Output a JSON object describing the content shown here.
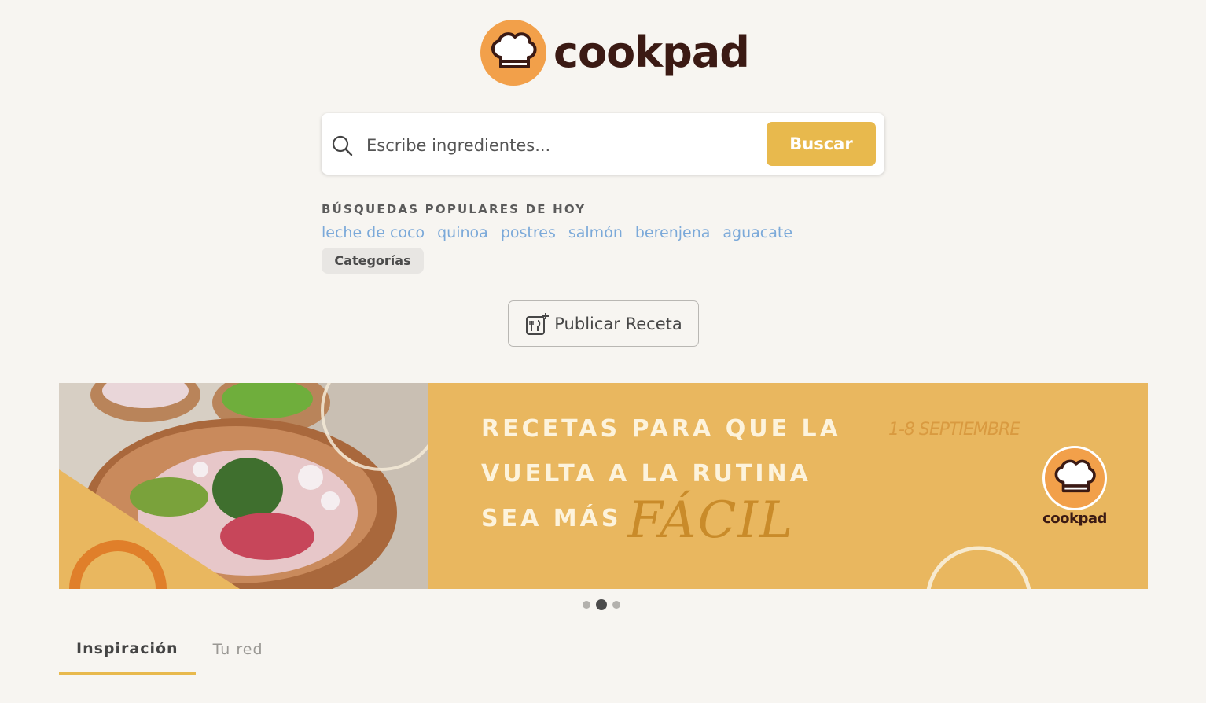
{
  "brand": {
    "name": "cookpad",
    "color": "#f2a04a",
    "accent": "#e8b94d"
  },
  "search": {
    "placeholder": "Escribe ingredientes...",
    "value": "",
    "button_label": "Buscar"
  },
  "popular": {
    "heading": "BÚSQUEDAS POPULARES DE HOY",
    "links": [
      "leche de coco",
      "quinoa",
      "postres",
      "salmón",
      "berenjena",
      "aguacate"
    ],
    "categories_label": "Categorías"
  },
  "publish": {
    "label": "Publicar Receta",
    "icon": "recipe-add-icon"
  },
  "banner": {
    "line1": "RECETAS PARA QUE LA",
    "line2": "VUELTA A LA RUTINA",
    "line3": "SEA MÁS",
    "highlight": "FÁCIL",
    "dates": "1-8 SEPTIEMBRE",
    "logo_text": "cookpad"
  },
  "carousel": {
    "total": 3,
    "active_index": 1
  },
  "tabs": [
    {
      "label": "Inspiración",
      "active": true
    },
    {
      "label": "Tu red",
      "active": false
    }
  ]
}
